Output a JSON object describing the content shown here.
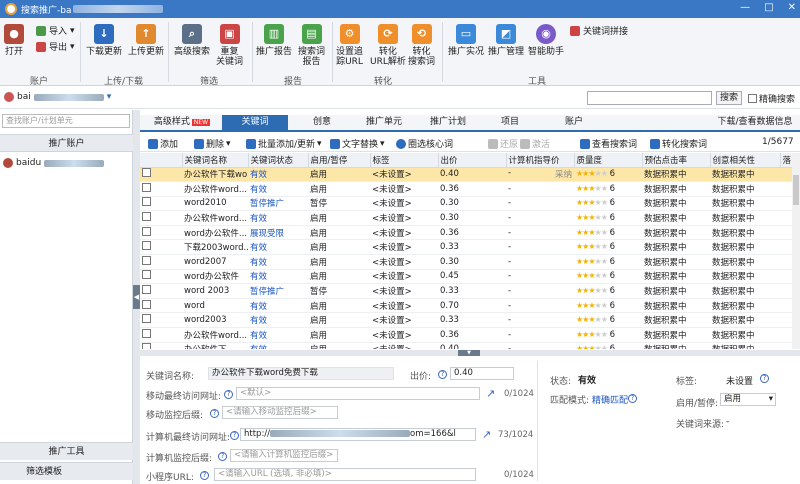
{
  "window": {
    "title": "搜索推广-ba",
    "min": "—",
    "max": "□",
    "close": "✕"
  },
  "ribbon": {
    "open": "打开",
    "import": "导入",
    "export": "导出",
    "download": "下载更新",
    "upload": "上传更新",
    "adv_search": "高级搜索",
    "dup_kw": "重复\n关键词",
    "promo_report": "推广报告",
    "search_report": "搜索词\n报告",
    "set_url": "设置追\n踪URL",
    "conv_url": "转化\nURL解析",
    "conv_kw": "转化\n搜索词",
    "promo_practice": "推广实况",
    "promo_mgmt": "推广管理",
    "smart": "智能助手",
    "kw_combine": "关键词拼接",
    "groups": [
      "账户",
      "上传/下载",
      "筛选",
      "报告",
      "转化",
      "工具"
    ]
  },
  "addr": {
    "account_prefix": "bai",
    "search_btn": "搜索",
    "exact": "精确搜索"
  },
  "left": {
    "search_ph": "查找账户/计划单元",
    "head": "推广账户",
    "acct": "baidu",
    "tools": "推广工具",
    "template": "筛选模板"
  },
  "tabs": {
    "adv": "高级样式",
    "new": "NEW",
    "kw": "关键词",
    "idea": "创意",
    "unit": "推广单元",
    "plan": "推广计划",
    "project": "项目",
    "account": "账户",
    "download": "下载/查看数据信息"
  },
  "toolbar": {
    "add": "添加",
    "delete": "删除",
    "batch": "批量添加/更新",
    "replace": "文字替换",
    "circle": "圈选核心词",
    "restore": "还原",
    "activate": "激活",
    "view_search": "查看搜索词",
    "conv_search": "转化搜索词",
    "count": "1/5677"
  },
  "grid": {
    "headers": [
      "关键词名称",
      "关键词状态",
      "启用/暂停",
      "标签",
      "出价",
      "计算机指导价",
      "质量度",
      "预估点击率",
      "创意相关性",
      "落"
    ],
    "rows": [
      {
        "kw": "办公软件下载wo",
        "status": "有效",
        "en": "启用",
        "tag": "<未设置>",
        "bid": "0.40",
        "guide": "-",
        "adopt": "采纳",
        "q": "6",
        "ctr": "数据积累中",
        "rel": "数据积累中"
      },
      {
        "kw": "办公软件word...",
        "status": "有效",
        "en": "启用",
        "tag": "<未设置>",
        "bid": "0.36",
        "guide": "-",
        "adopt": "",
        "q": "6",
        "ctr": "数据积累中",
        "rel": "数据积累中"
      },
      {
        "kw": "word2010",
        "status": "暂停推广",
        "en": "暂停",
        "tag": "<未设置>",
        "bid": "0.30",
        "guide": "-",
        "adopt": "",
        "q": "6",
        "ctr": "数据积累中",
        "rel": "数据积累中"
      },
      {
        "kw": "办公软件word...",
        "status": "有效",
        "en": "启用",
        "tag": "<未设置>",
        "bid": "0.30",
        "guide": "-",
        "adopt": "",
        "q": "6",
        "ctr": "数据积累中",
        "rel": "数据积累中"
      },
      {
        "kw": "word办公软件...",
        "status": "展现受限",
        "en": "启用",
        "tag": "<未设置>",
        "bid": "0.36",
        "guide": "-",
        "adopt": "",
        "q": "6",
        "ctr": "数据积累中",
        "rel": "数据积累中"
      },
      {
        "kw": "下载2003word...",
        "status": "有效",
        "en": "启用",
        "tag": "<未设置>",
        "bid": "0.33",
        "guide": "-",
        "adopt": "",
        "q": "6",
        "ctr": "数据积累中",
        "rel": "数据积累中"
      },
      {
        "kw": "word2007",
        "status": "有效",
        "en": "启用",
        "tag": "<未设置>",
        "bid": "0.30",
        "guide": "-",
        "adopt": "",
        "q": "6",
        "ctr": "数据积累中",
        "rel": "数据积累中"
      },
      {
        "kw": "word办公软件",
        "status": "有效",
        "en": "启用",
        "tag": "<未设置>",
        "bid": "0.45",
        "guide": "-",
        "adopt": "",
        "q": "6",
        "ctr": "数据积累中",
        "rel": "数据积累中"
      },
      {
        "kw": "word 2003",
        "status": "暂停推广",
        "en": "暂停",
        "tag": "<未设置>",
        "bid": "0.33",
        "guide": "-",
        "adopt": "",
        "q": "6",
        "ctr": "数据积累中",
        "rel": "数据积累中"
      },
      {
        "kw": "word",
        "status": "有效",
        "en": "启用",
        "tag": "<未设置>",
        "bid": "0.70",
        "guide": "-",
        "adopt": "",
        "q": "6",
        "ctr": "数据积累中",
        "rel": "数据积累中"
      },
      {
        "kw": "word2003",
        "status": "有效",
        "en": "启用",
        "tag": "<未设置>",
        "bid": "0.33",
        "guide": "-",
        "adopt": "",
        "q": "6",
        "ctr": "数据积累中",
        "rel": "数据积累中"
      },
      {
        "kw": "办公软件word...",
        "status": "有效",
        "en": "启用",
        "tag": "<未设置>",
        "bid": "0.36",
        "guide": "-",
        "adopt": "",
        "q": "6",
        "ctr": "数据积累中",
        "rel": "数据积累中"
      },
      {
        "kw": "办公软件下...",
        "status": "有效",
        "en": "启用",
        "tag": "<未设置>",
        "bid": "0.40",
        "guide": "-",
        "adopt": "",
        "q": "6",
        "ctr": "数据积累中",
        "rel": "数据积累中"
      }
    ]
  },
  "detail": {
    "kw_label": "关键词名称:",
    "kw_value": "办公软件下载word免费下载",
    "bid_label": "出价:",
    "bid_value": "0.40",
    "mob_url_label": "移动最终访问网址:",
    "mob_url_ph": "<默认>",
    "mob_url_cnt": "0/1024",
    "mob_mon_label": "移动监控后缀:",
    "mob_mon_ph": "<请输入移动监控后缀>",
    "pc_url_label": "计算机最终访问网址:",
    "pc_url_value": "http://",
    "pc_url_tail": "om=166&l",
    "pc_url_cnt": "73/1024",
    "pc_mon_label": "计算机监控后缀:",
    "pc_mon_ph": "<请输入计算机监控后缀>",
    "mini_label": "小程序URL:",
    "mini_ph": "<请输入URL (选填, 非必填)>",
    "mini_cnt": "0/1024",
    "status_label": "状态:",
    "status_value": "有效",
    "match_label": "匹配模式:",
    "match_value": "精确匹配",
    "tag_label": "标签:",
    "tag_value": "未设置",
    "en_label": "启用/暂停:",
    "en_value": "启用",
    "src_label": "关键词来源:",
    "src_value": "-"
  }
}
